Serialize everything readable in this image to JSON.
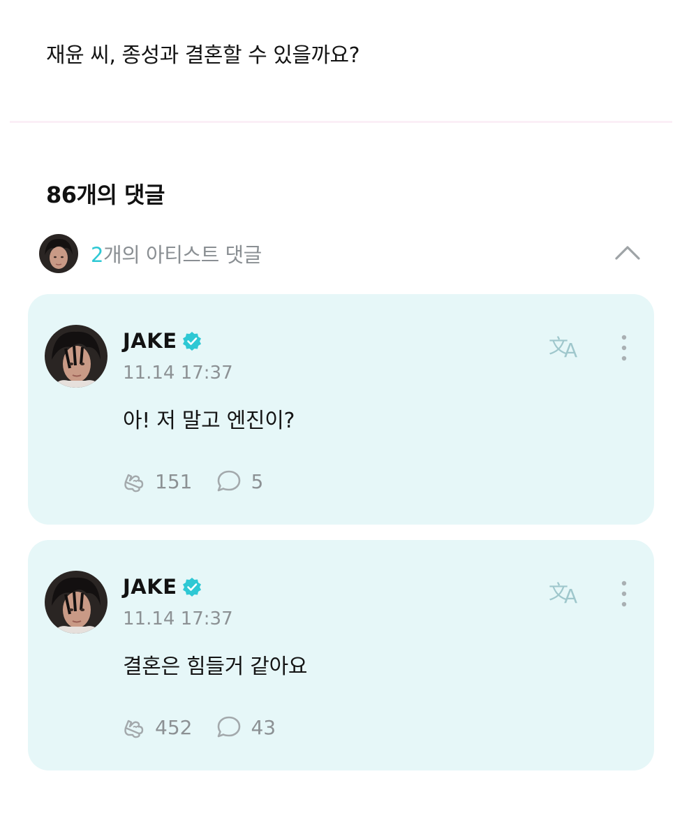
{
  "post": {
    "title": "재윤 씨, 종성과 결혼할 수 있을까요?"
  },
  "comments_header": {
    "count_label": "86개의 댓글"
  },
  "artist_comments": {
    "count": "2",
    "label": "개의 아티스트 댓글",
    "collapse_icon": "chevron-up-icon"
  },
  "comments": [
    {
      "author": "JAKE",
      "verified": true,
      "timestamp": "11.14 17:37",
      "text": "아! 저 말고 엔진이?",
      "likes": "151",
      "replies": "5"
    },
    {
      "author": "JAKE",
      "verified": true,
      "timestamp": "11.14 17:37",
      "text": "결혼은 힘들거 같아요",
      "likes": "452",
      "replies": "43"
    }
  ],
  "colors": {
    "accent": "#2ec8d4",
    "card_bg": "#e6f7f8",
    "muted_text": "#8c9194",
    "divider": "#fbeff6"
  },
  "icons": {
    "verified": "verified-badge-icon",
    "translate": "translate-icon",
    "more": "more-vertical-icon",
    "like": "heart-hands-icon",
    "reply": "speech-bubble-icon"
  }
}
